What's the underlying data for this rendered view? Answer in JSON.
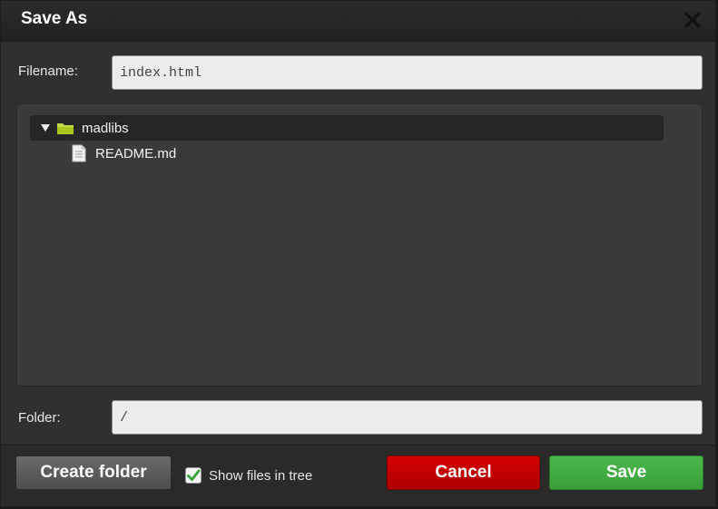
{
  "dialog": {
    "title": "Save As",
    "close_icon": "close-icon"
  },
  "filename": {
    "label": "Filename:",
    "value": "index.html"
  },
  "tree": {
    "items": [
      {
        "label": "madlibs",
        "type": "folder",
        "expanded": true,
        "selected": true,
        "icons": [
          "expand-arrow-icon",
          "folder-icon"
        ]
      },
      {
        "label": "README.md",
        "type": "file",
        "icon": "file-icon"
      }
    ]
  },
  "folder": {
    "label": "Folder:",
    "value": "/"
  },
  "footer": {
    "create_folder_label": "Create folder",
    "show_files_label": "Show files in tree",
    "show_files_checked": true,
    "cancel_label": "Cancel",
    "save_label": "Save"
  },
  "colors": {
    "dialog_bg": "#303030",
    "tree_bg": "#3a3a3a",
    "cancel": "#c80000",
    "save": "#44ad44",
    "folder_icon": "#a8c81e"
  }
}
